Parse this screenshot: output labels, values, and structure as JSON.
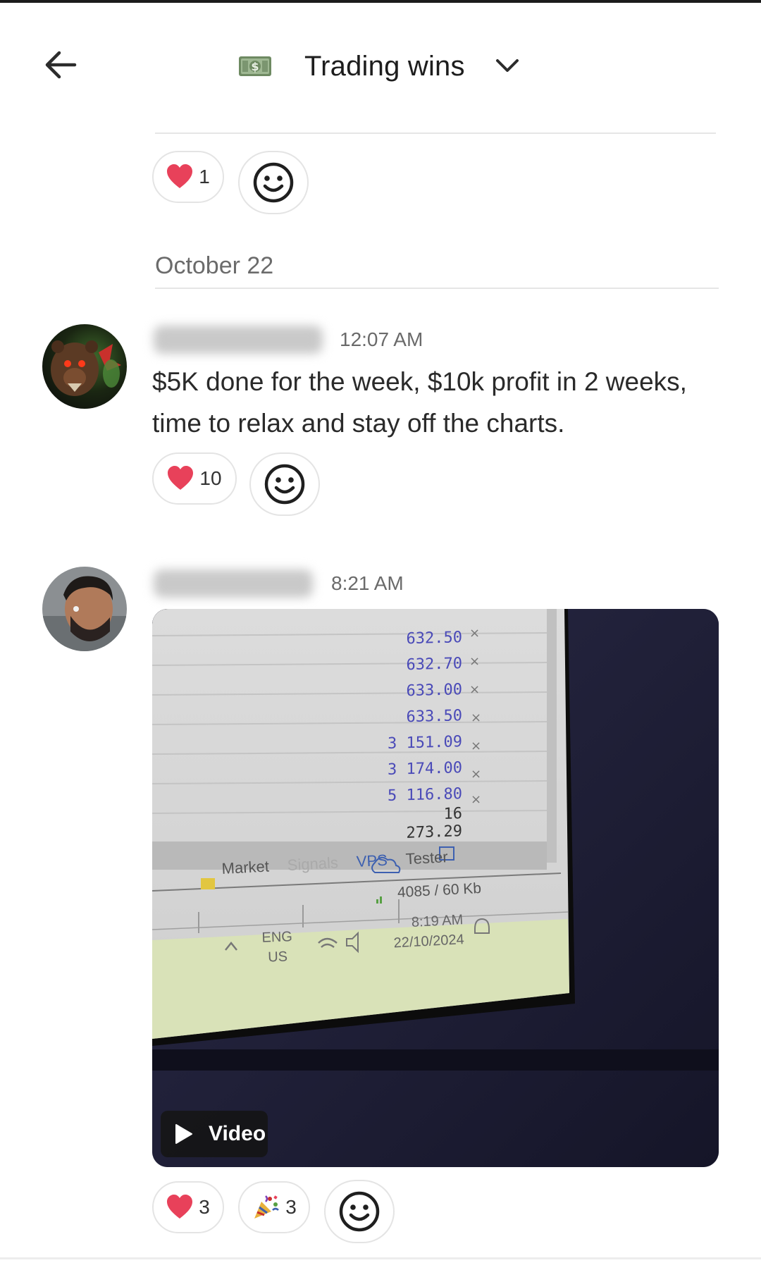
{
  "header": {
    "title": "Trading wins",
    "channel_icon": "money-bill-emoji",
    "back_icon": "back-arrow-icon",
    "dropdown_icon": "chevron-down-icon"
  },
  "first_post_reactions": [
    {
      "emoji": "heart",
      "count": "1"
    }
  ],
  "date_separator": "October 22",
  "messages": [
    {
      "time": "12:07 AM",
      "text": "$5K done for the week, $10k profit in 2 weeks, time to relax and stay off the charts.",
      "reactions": [
        {
          "emoji": "heart",
          "count": "10"
        }
      ]
    },
    {
      "time": "8:21 AM",
      "media": {
        "badge": "Video",
        "screen": {
          "values": [
            "632.50",
            "632.70",
            "633.00",
            "633.50",
            "3 151.09",
            "3 174.00",
            "5 116.80"
          ],
          "total": "16 273.29",
          "tabs": [
            "Market",
            "Signals",
            "VPS",
            "Tester"
          ],
          "status": "4085 / 60 Kb",
          "lang_line1": "ENG",
          "lang_line2": "US",
          "clock_time": "8:19 AM",
          "clock_date": "22/10/2024"
        }
      },
      "reactions": [
        {
          "emoji": "heart",
          "count": "3"
        },
        {
          "emoji": "party-popper",
          "count": "3"
        }
      ]
    }
  ],
  "colors": {
    "accent_heart": "#e8415a",
    "chip_border": "#e4e4e4",
    "muted_text": "#6b6b6b"
  }
}
